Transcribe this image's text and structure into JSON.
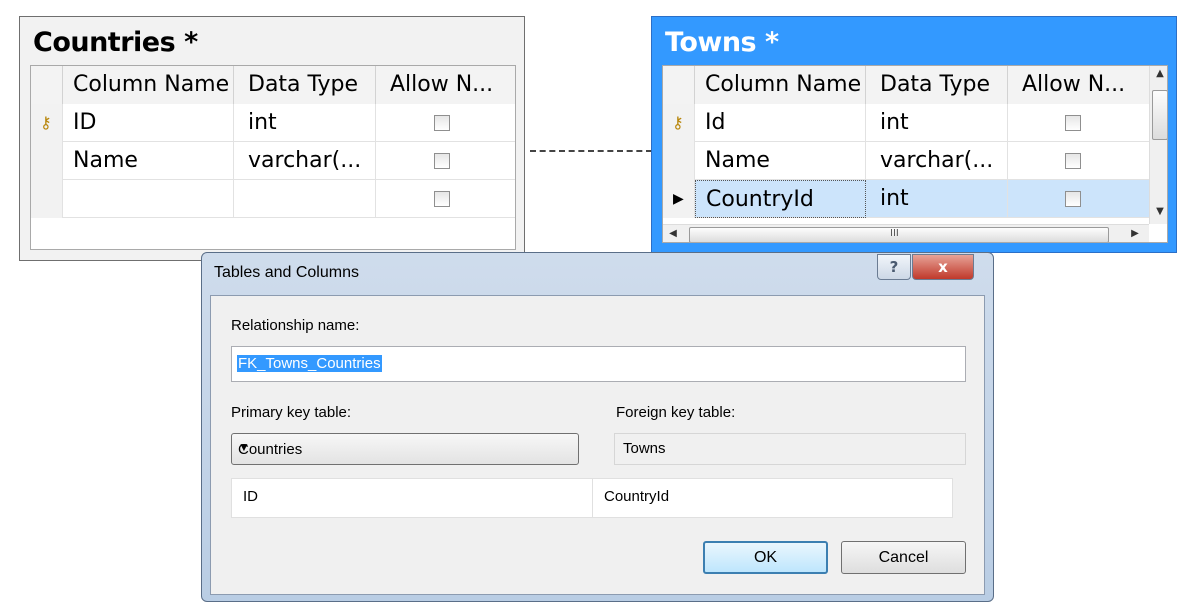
{
  "countries_table": {
    "title": "Countries *",
    "headers": [
      "Column Name",
      "Data Type",
      "Allow N..."
    ],
    "rows": [
      {
        "name": "ID",
        "type": "int",
        "key": true
      },
      {
        "name": "Name",
        "type": "varchar(...",
        "key": false
      },
      {
        "name": "",
        "type": "",
        "key": false
      }
    ]
  },
  "towns_table": {
    "title": "Towns *",
    "headers": [
      "Column Name",
      "Data Type",
      "Allow N..."
    ],
    "rows": [
      {
        "name": "Id",
        "type": "int",
        "key": true
      },
      {
        "name": "Name",
        "type": "varchar(...",
        "key": false
      },
      {
        "name": "CountryId",
        "type": "int",
        "key": false,
        "current": true
      }
    ],
    "scroll_grip": "III"
  },
  "dialog": {
    "title": "Tables and Columns",
    "help_label": "?",
    "close_label": "x",
    "relationship_label": "Relationship name:",
    "relationship_value": "FK_Towns_Countries",
    "pk_label": "Primary key table:",
    "pk_value": "Countries",
    "fk_label": "Foreign key table:",
    "fk_value": "Towns",
    "mapping": {
      "pk_column": "ID",
      "fk_column": "CountryId"
    },
    "ok_label": "OK",
    "cancel_label": "Cancel"
  },
  "colors": {
    "selection": "#3399ff",
    "current_row": "#cce4fb"
  }
}
